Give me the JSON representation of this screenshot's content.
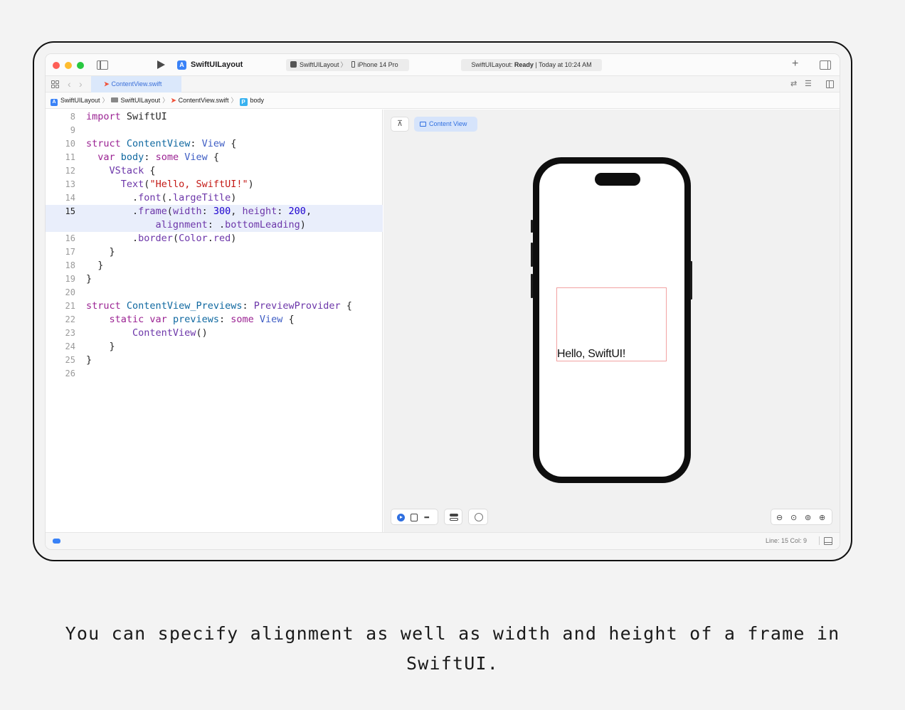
{
  "toolbar": {
    "project_name": "SwiftUILayout",
    "scheme_project": "SwiftUILayout",
    "scheme_device": "iPhone 14 Pro",
    "status_project": "SwiftUILayout: ",
    "status_state": "Ready",
    "status_time": " | Today at 10:24 AM"
  },
  "tab": {
    "label": "ContentView.swift"
  },
  "breadcrumb": {
    "items": [
      "SwiftUILayout",
      "SwiftUILayout",
      "ContentView.swift",
      "body"
    ]
  },
  "editor": {
    "current_line": 15,
    "line_numbers": [
      "8",
      "9",
      "10",
      "11",
      "12",
      "13",
      "14",
      "15",
      "",
      "16",
      "17",
      "18",
      "19",
      "20",
      "21",
      "22",
      "23",
      "24",
      "25",
      "26"
    ],
    "lines": [
      "import SwiftUI",
      "",
      "struct ContentView: View {",
      "  var body: some View {",
      "    VStack {",
      "      Text(\"Hello, SwiftUI!\")",
      "        .font(.largeTitle)",
      "        .frame(width: 300, height: 200,",
      "            alignment: .bottomLeading)",
      "        .border(Color.red)",
      "    }",
      "  }",
      "}",
      "",
      "struct ContentView_Previews: PreviewProvider {",
      "    static var previews: some View {",
      "        ContentView()",
      "    }",
      "}",
      ""
    ]
  },
  "preview": {
    "pin_icon": "pin-icon",
    "content_view_label": "Content View",
    "rendered_text": "Hello, SwiftUI!"
  },
  "statusbar": {
    "line_col": "Line: 15  Col: 9"
  },
  "caption": "You can specify alignment as well as width and height of a frame in SwiftUI."
}
